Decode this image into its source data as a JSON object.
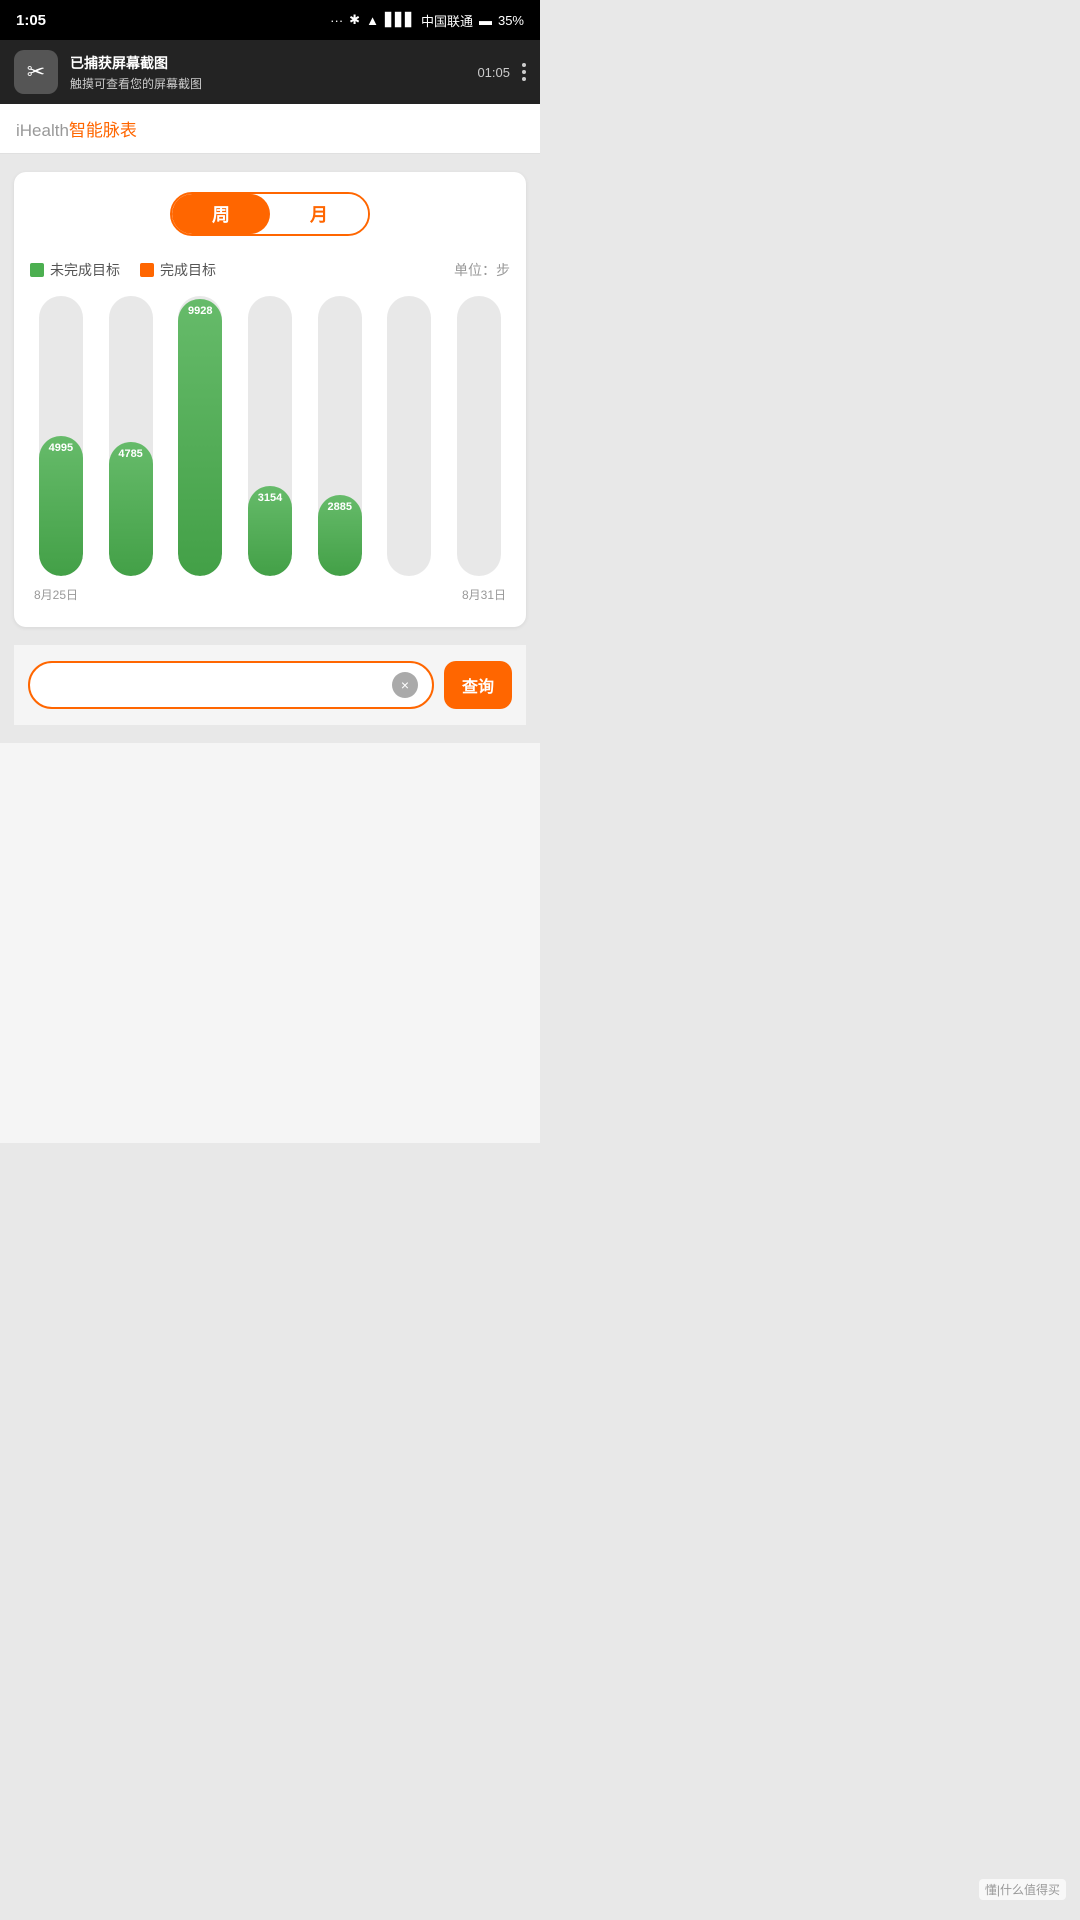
{
  "status_bar": {
    "time": "1:05",
    "carrier": "中国联通",
    "battery": "35%"
  },
  "notification": {
    "title": "已捕获屏幕截图",
    "subtitle": "触摸可查看您的屏幕截图",
    "time": "01:05",
    "icon": "✂"
  },
  "app_header": {
    "title_prefix": "iHealth",
    "title_suffix": "智能脉表"
  },
  "period_toggle": {
    "week_label": "周",
    "month_label": "月",
    "active": "week"
  },
  "legend": {
    "incomplete_label": "未完成目标",
    "complete_label": "完成目标",
    "unit_label": "单位：步"
  },
  "chart": {
    "bars": [
      {
        "value": 4995,
        "color": "green",
        "height_pct": 50
      },
      {
        "value": 4785,
        "color": "green",
        "height_pct": 48
      },
      {
        "value": 9928,
        "color": "green",
        "height_pct": 99
      },
      {
        "value": 3154,
        "color": "green",
        "height_pct": 32
      },
      {
        "value": 2885,
        "color": "green",
        "height_pct": 29
      },
      {
        "value": 0,
        "color": "empty",
        "height_pct": 0
      },
      {
        "value": 0,
        "color": "empty",
        "height_pct": 0
      }
    ],
    "start_date": "8月25日",
    "end_date": "8月31日"
  },
  "search": {
    "placeholder": "",
    "query_button_label": "查询",
    "clear_icon": "×"
  },
  "watermark": {
    "text": "懂|什么值得买"
  }
}
